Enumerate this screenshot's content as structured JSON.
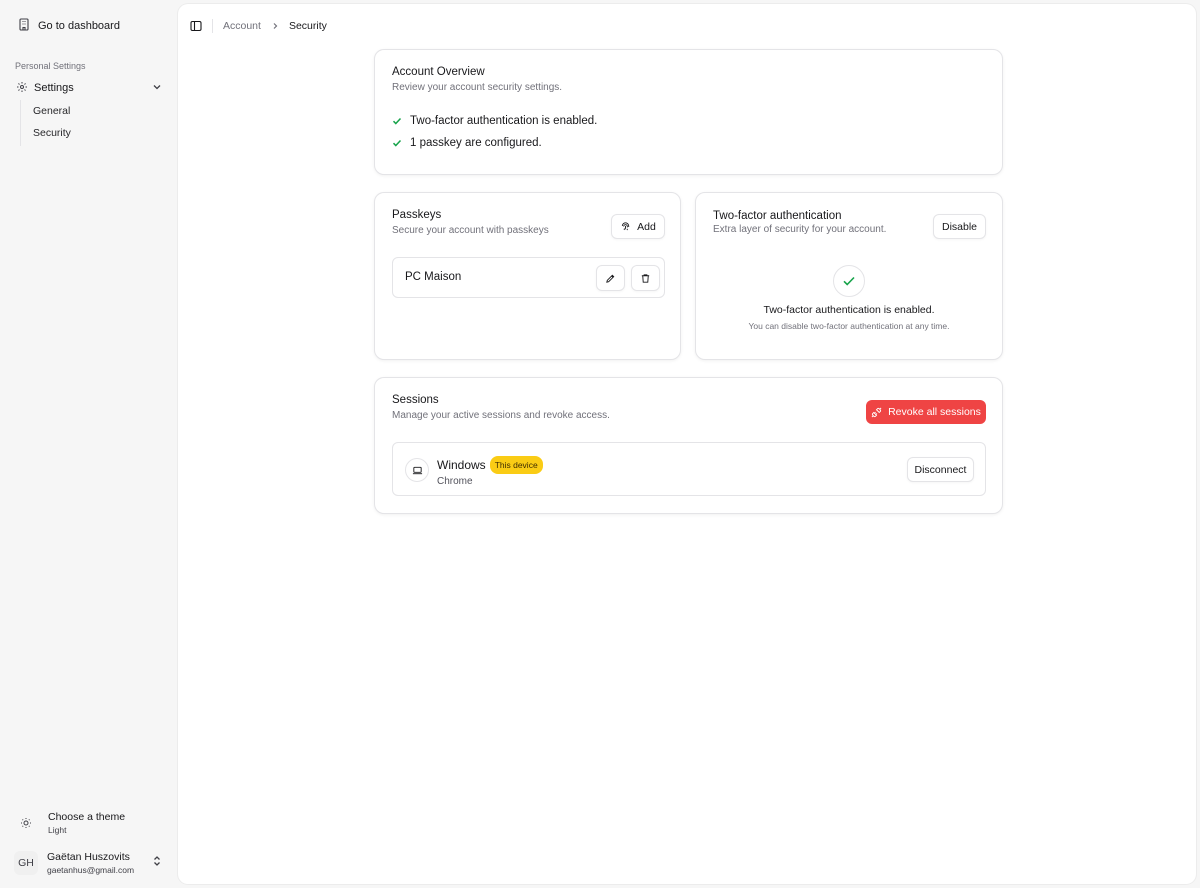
{
  "sidebar": {
    "dashboard_label": "Go to dashboard",
    "section_label": "Personal Settings",
    "settings_label": "Settings",
    "sub_items": [
      "General",
      "Security"
    ],
    "theme": {
      "title": "Choose a theme",
      "value": "Light"
    },
    "user": {
      "initials": "GH",
      "name": "Gaëtan Huszovits",
      "email": "gaetanhus@gmail.com"
    }
  },
  "breadcrumb": {
    "parent": "Account",
    "current": "Security"
  },
  "overview": {
    "title": "Account Overview",
    "description": "Review your account security settings.",
    "items": [
      "Two-factor authentication is enabled.",
      "1 passkey are configured."
    ]
  },
  "passkeys": {
    "title": "Passkeys",
    "description": "Secure your account with passkeys",
    "add_label": "Add",
    "items": [
      {
        "name": "PC Maison"
      }
    ]
  },
  "two_factor": {
    "title": "Two-factor authentication",
    "description": "Extra layer of security for your account.",
    "disable_label": "Disable",
    "status_title": "Two-factor authentication is enabled.",
    "status_desc": "You can disable two-factor authentication at any time."
  },
  "sessions": {
    "title": "Sessions",
    "description": "Manage your active sessions and revoke access.",
    "revoke_label": "Revoke all sessions",
    "items": [
      {
        "os": "Windows",
        "badge": "This device",
        "browser": "Chrome",
        "action": "Disconnect"
      }
    ]
  },
  "colors": {
    "check_green": "#16a34a",
    "danger": "#ef4444",
    "badge_yellow": "#facc15"
  },
  "icons": {
    "dashboard": "building-icon",
    "settings": "gear-icon",
    "chevron": "chevron-down-icon",
    "theme": "sun-icon",
    "user_menu": "chevrons-up-down-icon",
    "sidebar_toggle": "panel-left-icon",
    "check": "check-icon",
    "passkey": "fingerprint-icon",
    "edit": "pencil-icon",
    "delete": "trash-icon",
    "revoke": "unplug-icon",
    "device": "laptop-icon"
  }
}
